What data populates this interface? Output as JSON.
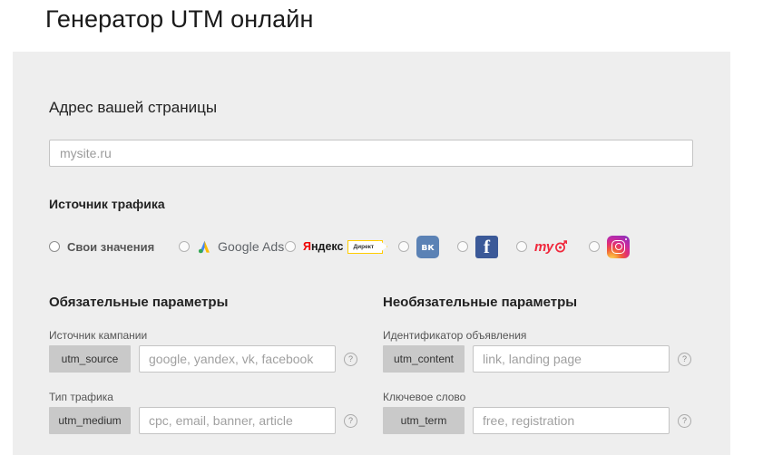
{
  "page_title": "Генератор UTM онлайн",
  "url_section": {
    "heading": "Адрес вашей страницы",
    "placeholder": "mysite.ru",
    "value": ""
  },
  "traffic_source": {
    "heading": "Источник трафика",
    "options": [
      {
        "id": "custom",
        "label": "Свои значения",
        "icon": "radio-icon",
        "selected": false
      },
      {
        "id": "google-ads",
        "label": "Google Ads",
        "icon": "google-ads-icon",
        "selected": false
      },
      {
        "id": "yandex",
        "label": "Яндекс",
        "badge": "Директ",
        "icon": "yandex-direct-icon",
        "selected": false
      },
      {
        "id": "vk",
        "label": "VK",
        "icon": "vk-icon",
        "selected": false
      },
      {
        "id": "facebook",
        "label": "Facebook",
        "icon": "facebook-icon",
        "selected": false
      },
      {
        "id": "mytarget",
        "label": "myTarget",
        "icon": "mytarget-icon",
        "selected": false
      },
      {
        "id": "instagram",
        "label": "Instagram",
        "icon": "instagram-icon",
        "selected": false
      }
    ]
  },
  "required_params": {
    "heading": "Обязательные параметры",
    "fields": [
      {
        "label": "Источник кампании",
        "tag": "utm_source",
        "placeholder": "google, yandex, vk, facebook",
        "value": "",
        "help": "?"
      },
      {
        "label": "Тип трафика",
        "tag": "utm_medium",
        "placeholder": "cpc, email, banner, article",
        "value": "",
        "help": "?"
      }
    ]
  },
  "optional_params": {
    "heading": "Необязательные параметры",
    "fields": [
      {
        "label": "Идентификатор объявления",
        "tag": "utm_content",
        "placeholder": "link, landing page",
        "value": "",
        "help": "?"
      },
      {
        "label": "Ключевое слово",
        "tag": "utm_term",
        "placeholder": "free, registration",
        "value": "",
        "help": "?"
      }
    ]
  },
  "colors": {
    "panel_bg": "#eeeeee",
    "tag_bg": "#c9c9c9",
    "vk": "#5b82b5",
    "facebook": "#3b5998",
    "mytarget": "#f0283c",
    "yandex_red": "#ee0000",
    "direct_yellow": "#ffcc00"
  }
}
